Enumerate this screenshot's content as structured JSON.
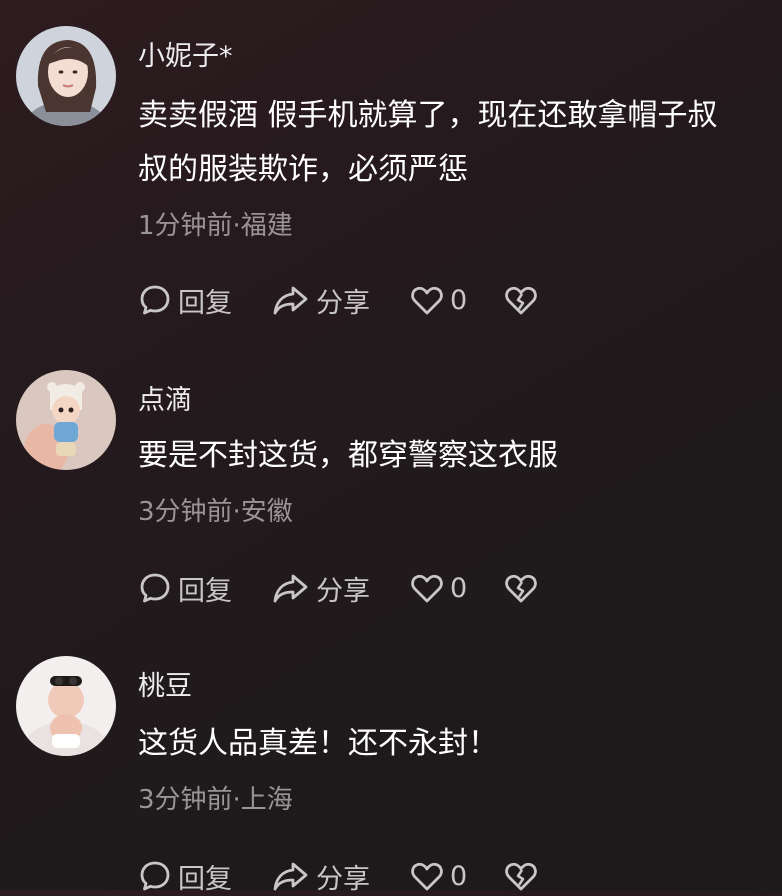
{
  "actions": {
    "reply_label": "回复",
    "share_label": "分享"
  },
  "comments": [
    {
      "username": "小妮子*",
      "lines": [
        "卖卖假酒 假手机就算了，现在还敢拿帽子叔",
        "叔的服装欺诈，必须严惩"
      ],
      "meta": "1分钟前·福建",
      "likes": "0"
    },
    {
      "username": "点滴",
      "lines": [
        "要是不封这货，都穿警察这衣服"
      ],
      "meta": "3分钟前·安徽",
      "likes": "0"
    },
    {
      "username": "桃豆",
      "lines": [
        "这货人品真差！还不永封！"
      ],
      "meta": "3分钟前·上海",
      "likes": "0"
    }
  ],
  "icons": {
    "reply": "speech-bubble-icon",
    "share": "share-arrow-icon",
    "like": "heart-icon",
    "dislike": "broken-heart-icon"
  }
}
